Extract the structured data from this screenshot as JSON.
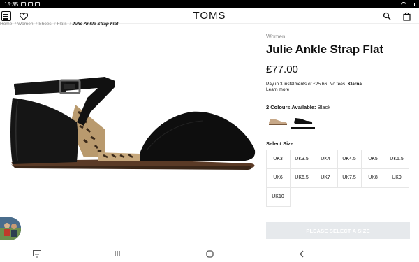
{
  "statusbar": {
    "time": "15:35"
  },
  "header": {
    "logo": "TOMS"
  },
  "breadcrumb": {
    "items": [
      "Home",
      "Women",
      "Shoes",
      "Flats"
    ],
    "current": "Julie Ankle Strap Flat"
  },
  "product": {
    "category": "Women",
    "title": "Julie Ankle Strap Flat",
    "price": "£77.00",
    "klarna_text": "Pay in 3 instalments of £25.66. No fees.",
    "klarna_brand": "Klarna.",
    "learn_more": "Learn more",
    "colours_label": "2 Colours Available:",
    "colours_selected": "Black",
    "select_size_label": "Select Size:",
    "sizes": [
      "UK3",
      "UK3.5",
      "UK4",
      "UK4.5",
      "UK5",
      "UK5.5",
      "UK6",
      "UK6.5",
      "UK7",
      "UK7.5",
      "UK8",
      "UK9",
      "UK10"
    ],
    "cta": "PLEASE SELECT A SIZE"
  },
  "colors": {
    "cta_bg": "#e6e9ec",
    "text": "#1a1a1a",
    "muted": "#8a8a8a"
  },
  "icons": [
    "menu-icon",
    "heart-icon",
    "search-icon",
    "bag-icon",
    "recent-apps-icon",
    "home-icon",
    "back-icon",
    "keyboard-icon"
  ]
}
